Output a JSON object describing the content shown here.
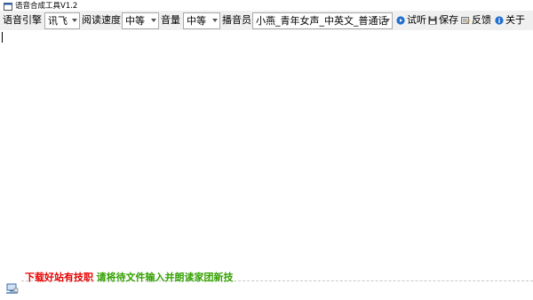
{
  "window": {
    "title": "语音合成工具V1.2"
  },
  "toolbar": {
    "engine_label": "语音引擎",
    "engine_value": "讯飞",
    "speed_label": "阅读速度",
    "speed_value": "中等",
    "volume_label": "音量",
    "volume_value": "中等",
    "speaker_label": "播音员",
    "speaker_value": "小燕_青年女声_中英文_普通话",
    "preview_label": "试听",
    "save_label": "保存",
    "feedback_label": "反馈",
    "about_label": "关于"
  },
  "editor": {
    "text": ""
  },
  "status": {
    "notice_red": "下载好站有技职",
    "notice_green": "请将待文件输入并朗读家团新技"
  },
  "colors": {
    "toolbar_bg": "#f0f0f0",
    "notice_red": "#e60000",
    "notice_green": "#33a000",
    "icon_blue": "#1e6fd0"
  },
  "icons": {
    "app": "speaker-window-icon",
    "preview": "play-circle-icon",
    "save": "floppy-disk-icon",
    "feedback": "feedback-icon",
    "about": "info-icon",
    "status": "network-icon"
  }
}
